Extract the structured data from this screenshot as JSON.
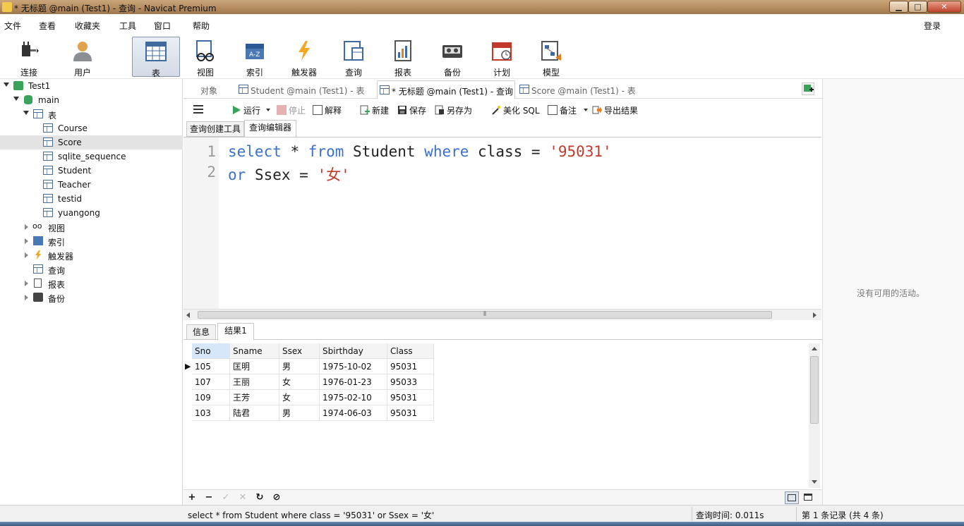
{
  "window": {
    "title": "* 无标题 @main (Test1) - 查询 - Navicat Premium",
    "btn_min": "▁",
    "btn_max": "□",
    "btn_close": "✕"
  },
  "menu": {
    "items": [
      "文件",
      "查看",
      "收藏夹",
      "工具",
      "窗口",
      "帮助"
    ],
    "login": "登录"
  },
  "toolbar": {
    "buttons": [
      "连接",
      "用户",
      "表",
      "视图",
      "索引",
      "触发器",
      "查询",
      "报表",
      "备份",
      "计划",
      "模型"
    ]
  },
  "tree": {
    "connection": "Test1",
    "database": "main",
    "tables_group": "表",
    "tables": [
      "Course",
      "Score",
      "sqlite_sequence",
      "Student",
      "Teacher",
      "testid",
      "yuangong"
    ],
    "selected_table": "Score",
    "groups": [
      "视图",
      "索引",
      "触发器",
      "查询",
      "报表",
      "备份"
    ]
  },
  "tabs": {
    "objects": "对象",
    "items": [
      "Student @main (Test1) - 表",
      "* 无标题 @main (Test1) - 查询",
      "Score @main (Test1) - 表"
    ],
    "active": "* 无标题 @main (Test1) - 查询"
  },
  "query_toolbar": {
    "run": "运行",
    "stop": "停止",
    "explain": "解释",
    "new": "新建",
    "save": "保存",
    "save_as": "另存为",
    "beautify": "美化 SQL",
    "comment": "备注",
    "export": "导出结果"
  },
  "subtabs": {
    "builder": "查询创建工具",
    "editor": "查询编辑器"
  },
  "editor": {
    "line_numbers": [
      "1",
      "2"
    ],
    "line1": {
      "kw1": "select",
      "t1": " * ",
      "kw2": "from",
      "t2": " Student ",
      "kw3": "where",
      "t3": " class = ",
      "s1": "'95031'"
    },
    "line2": {
      "kw1": "or",
      "t1": " Ssex = ",
      "s1": "'女'"
    },
    "scroll_grip": "⦀"
  },
  "results_tabs": {
    "info": "信息",
    "result1": "结果1"
  },
  "grid": {
    "columns": [
      "Sno",
      "Sname",
      "Ssex",
      "Sbirthday",
      "Class"
    ],
    "rows": [
      [
        "105",
        "匡明",
        "男",
        "1975-10-02",
        "95031"
      ],
      [
        "107",
        "王丽",
        "女",
        "1976-01-23",
        "95033"
      ],
      [
        "109",
        "王芳",
        "女",
        "1975-02-10",
        "95031"
      ],
      [
        "103",
        "陆君",
        "男",
        "1974-06-03",
        "95031"
      ]
    ],
    "current_row_marker": "▶"
  },
  "grid_bar": {
    "add": "+",
    "remove": "−",
    "apply": "✓",
    "discard": "✕",
    "refresh": "↻",
    "stop": "⊘"
  },
  "status": {
    "sql": "select * from Student where class = '95031'  or Ssex = '女'",
    "query_time": "查询时间: 0.011s",
    "record": "第 1 条记录 (共 4 条)"
  },
  "right_panel": {
    "empty_text": "没有可用的活动。"
  },
  "colors": {
    "keyword": "#3b6fd0",
    "string": "#c0392b",
    "selected_header": "#d6e7fa"
  }
}
